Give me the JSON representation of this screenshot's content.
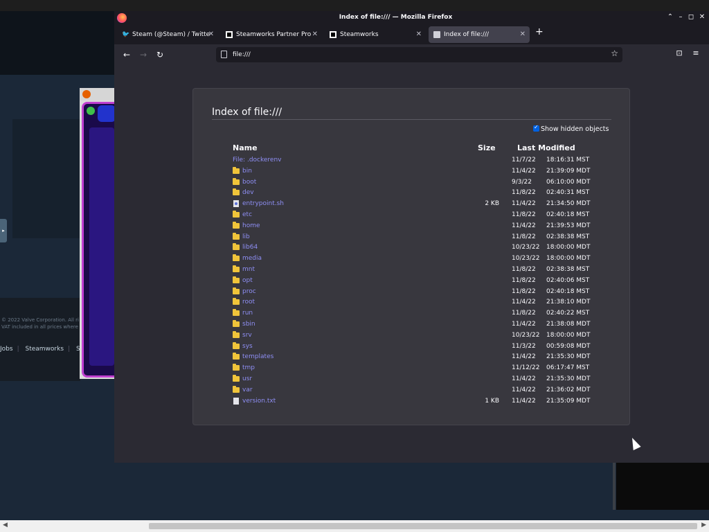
{
  "background": {
    "footer_lines": [
      "© 2022 Valve Corporation. All ri",
      "VAT included in all prices where"
    ],
    "footer_links": [
      "Jobs",
      "Steamworks",
      "Stea"
    ],
    "side_handle": "▸"
  },
  "window": {
    "title": "Index of file:/// — Mozilla Firefox",
    "controls": {
      "up": "⌃",
      "minimize": "–",
      "maximize": "◻",
      "close": "✕"
    }
  },
  "tabs": [
    {
      "label": "Steam (@Steam) / Twitte",
      "icon": "twitter-icon"
    },
    {
      "label": "Steamworks Partner Pro",
      "icon": "steam-icon"
    },
    {
      "label": "Steamworks",
      "icon": "steam-icon"
    },
    {
      "label": "Index of file:///",
      "icon": "file-icon",
      "active": true
    }
  ],
  "new_tab": "+",
  "tab_close": "✕",
  "nav": {
    "back": "←",
    "forward": "→",
    "reload": "↻",
    "url": "file:///",
    "bookmark": "☆",
    "pocket": "⊡",
    "menu": "≡"
  },
  "listing": {
    "heading": "Index of file:///",
    "show_hidden_label": "Show hidden objects",
    "columns": {
      "name": "Name",
      "size": "Size",
      "modified": "Last Modified"
    },
    "rows": [
      {
        "name": "File: .dockerenv",
        "type": "file-link",
        "size": "",
        "date": "11/7/22",
        "time": "18:16:31 MST"
      },
      {
        "name": "bin",
        "type": "folder",
        "size": "",
        "date": "11/4/22",
        "time": "21:39:09 MDT"
      },
      {
        "name": "boot",
        "type": "folder",
        "size": "",
        "date": "9/3/22",
        "time": "06:10:00 MDT"
      },
      {
        "name": "dev",
        "type": "folder",
        "size": "",
        "date": "11/8/22",
        "time": "02:40:31 MST"
      },
      {
        "name": "entrypoint.sh",
        "type": "exec",
        "size": "2 KB",
        "date": "11/4/22",
        "time": "21:34:50 MDT"
      },
      {
        "name": "etc",
        "type": "folder",
        "size": "",
        "date": "11/8/22",
        "time": "02:40:18 MST"
      },
      {
        "name": "home",
        "type": "folder",
        "size": "",
        "date": "11/4/22",
        "time": "21:39:53 MDT"
      },
      {
        "name": "lib",
        "type": "folder",
        "size": "",
        "date": "11/8/22",
        "time": "02:38:38 MST"
      },
      {
        "name": "lib64",
        "type": "folder",
        "size": "",
        "date": "10/23/22",
        "time": "18:00:00 MDT"
      },
      {
        "name": "media",
        "type": "folder",
        "size": "",
        "date": "10/23/22",
        "time": "18:00:00 MDT"
      },
      {
        "name": "mnt",
        "type": "folder",
        "size": "",
        "date": "11/8/22",
        "time": "02:38:38 MST"
      },
      {
        "name": "opt",
        "type": "folder",
        "size": "",
        "date": "11/8/22",
        "time": "02:40:06 MST"
      },
      {
        "name": "proc",
        "type": "folder",
        "size": "",
        "date": "11/8/22",
        "time": "02:40:18 MST"
      },
      {
        "name": "root",
        "type": "folder",
        "size": "",
        "date": "11/4/22",
        "time": "21:38:10 MDT"
      },
      {
        "name": "run",
        "type": "folder",
        "size": "",
        "date": "11/8/22",
        "time": "02:40:22 MST"
      },
      {
        "name": "sbin",
        "type": "folder",
        "size": "",
        "date": "11/4/22",
        "time": "21:38:08 MDT"
      },
      {
        "name": "srv",
        "type": "folder",
        "size": "",
        "date": "10/23/22",
        "time": "18:00:00 MDT"
      },
      {
        "name": "sys",
        "type": "folder",
        "size": "",
        "date": "11/3/22",
        "time": "00:59:08 MDT"
      },
      {
        "name": "templates",
        "type": "folder",
        "size": "",
        "date": "11/4/22",
        "time": "21:35:30 MDT"
      },
      {
        "name": "tmp",
        "type": "folder",
        "size": "",
        "date": "11/12/22",
        "time": "06:17:47 MST"
      },
      {
        "name": "usr",
        "type": "folder",
        "size": "",
        "date": "11/4/22",
        "time": "21:35:30 MDT"
      },
      {
        "name": "var",
        "type": "folder",
        "size": "",
        "date": "11/4/22",
        "time": "21:36:02 MDT"
      },
      {
        "name": "version.txt",
        "type": "file",
        "size": "1 KB",
        "date": "11/4/22",
        "time": "21:35:09 MDT"
      }
    ]
  },
  "scrollbar": {
    "left_arrow": "◀",
    "right_arrow": "▶"
  }
}
